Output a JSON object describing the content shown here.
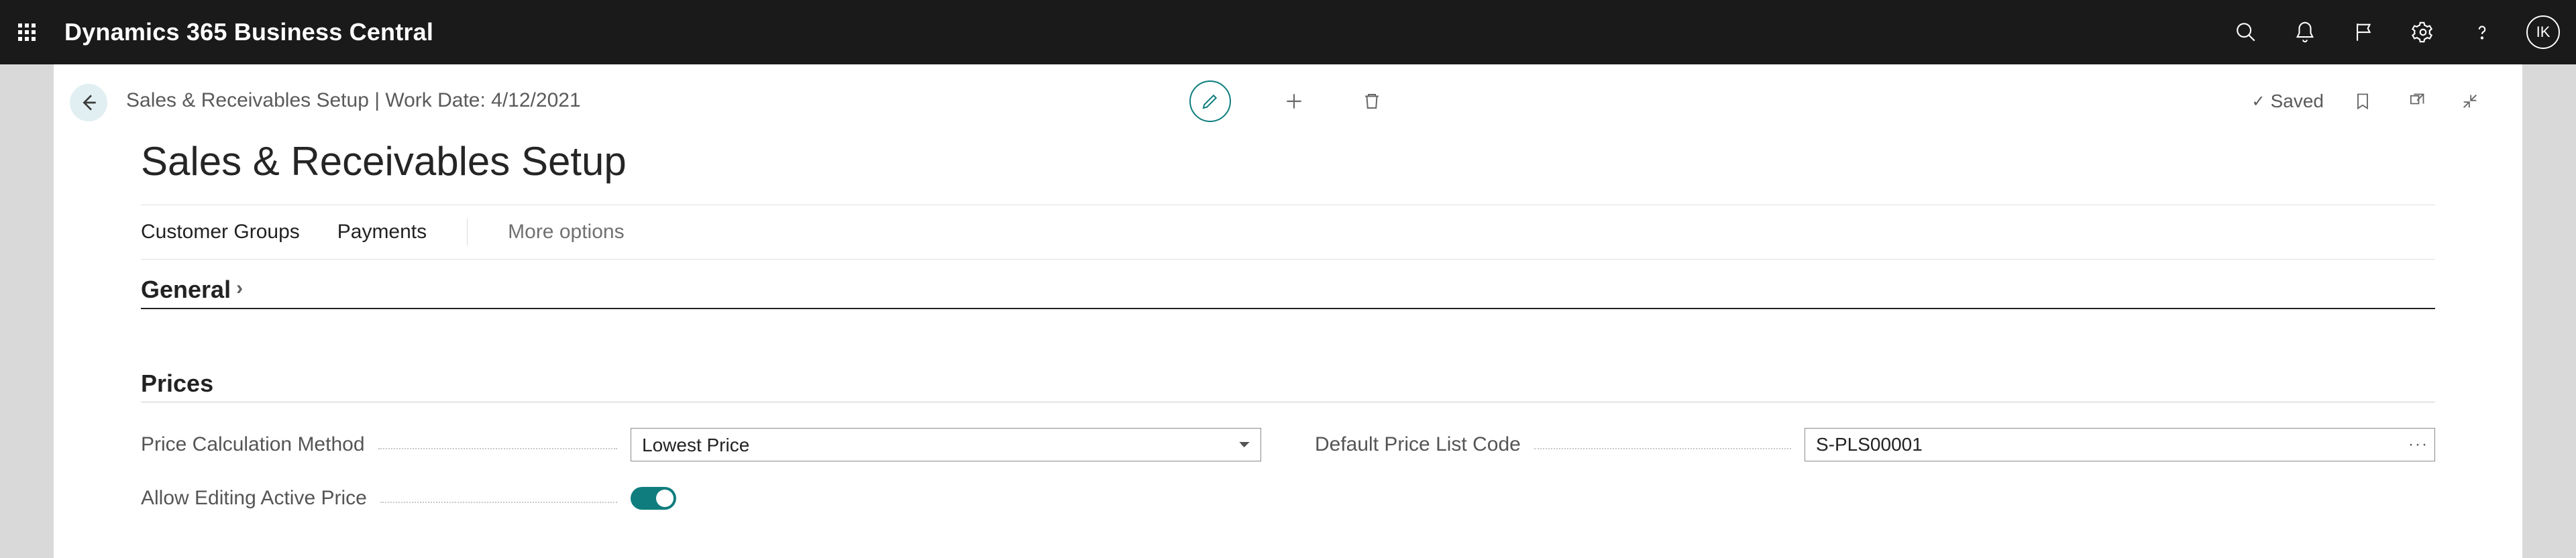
{
  "topbar": {
    "app_title": "Dynamics 365 Business Central",
    "user_initials": "IK"
  },
  "header": {
    "breadcrumb": "Sales & Receivables Setup | Work Date: 4/12/2021",
    "saved_label": "Saved"
  },
  "page": {
    "title": "Sales & Receivables Setup"
  },
  "actions": {
    "customer_groups": "Customer Groups",
    "payments": "Payments",
    "more_options": "More options"
  },
  "sections": {
    "general_label": "General",
    "prices_label": "Prices"
  },
  "fields": {
    "price_calc_method": {
      "label": "Price Calculation Method",
      "value": "Lowest Price"
    },
    "default_price_list_code": {
      "label": "Default Price List Code",
      "value": "S-PLS00001"
    },
    "allow_editing_active_price": {
      "label": "Allow Editing Active Price",
      "value": true
    }
  }
}
